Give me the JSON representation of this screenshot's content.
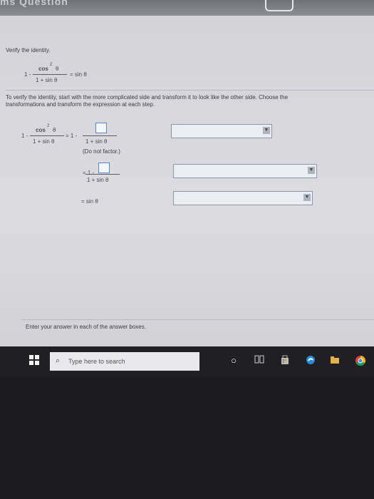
{
  "header": {
    "title": "ms Question"
  },
  "problem": {
    "prompt": "Verify the identity.",
    "identity": {
      "lhs_prefix": "1 -",
      "numerator": "cos",
      "exponent": "2",
      "numerator_var": "θ",
      "denominator": "1 + sin θ",
      "rhs": "= sin θ"
    }
  },
  "instructions": {
    "line1": "To verify the identity, start with the more complicated side and transform it to look like the other side. Choose the",
    "line2": "transformations and transform the expression at each step."
  },
  "steps": [
    {
      "lhs_prefix": "1 -",
      "numerator": "cos",
      "exponent": "2",
      "numerator_var": "θ",
      "denominator": "1 + sin θ",
      "equals": "= 1 -",
      "rhs_denominator": "1 + sin θ",
      "note": "(Do not factor.)"
    },
    {
      "equals": "= 1 -",
      "rhs_denominator": "1 + sin θ"
    },
    {
      "equals": "= sin θ"
    }
  ],
  "dropdowns": [
    {
      "value": ""
    },
    {
      "value": ""
    },
    {
      "value": ""
    }
  ],
  "footer": {
    "hint": "Enter your answer in each of the answer boxes."
  },
  "taskbar": {
    "search_placeholder": "Type here to search"
  }
}
